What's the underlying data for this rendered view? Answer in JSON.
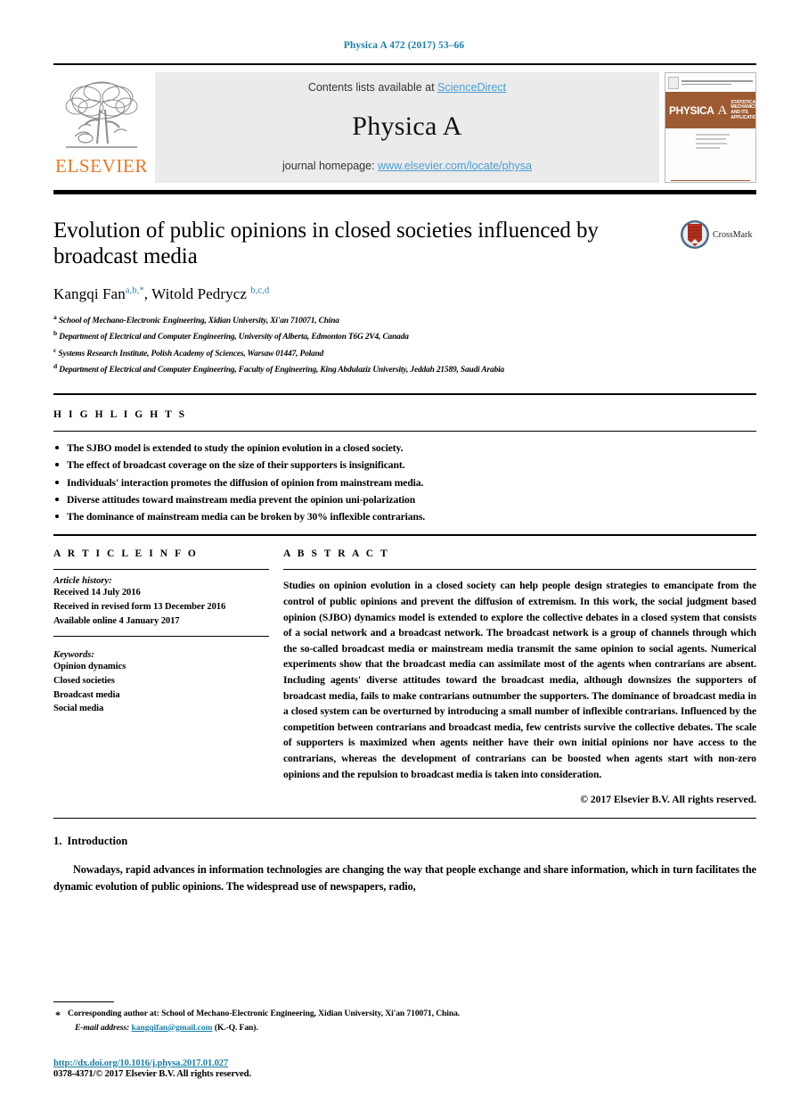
{
  "running_head": "Physica A 472 (2017) 53–66",
  "banner": {
    "publisher_logo_name": "elsevier-tree-logo",
    "publisher_wordmark": "ELSEVIER",
    "contents_prefix": "Contents lists available at ",
    "contents_link": "ScienceDirect",
    "journal_title": "Physica A",
    "homepage_prefix": "journal homepage: ",
    "homepage_link": "www.elsevier.com/locate/physa",
    "cover": {
      "title": "PHYSICA",
      "letter": "A",
      "subtitle": "STATISTICAL MECHANICS AND ITS APPLICATIONS"
    }
  },
  "article": {
    "title": "Evolution of public opinions in closed societies influenced by broadcast media",
    "crossmark_label": "CrossMark",
    "authors_html": "Kangqi Fan<sup>a,b,*</sup>, Witold Pedrycz <sup>b,c,d</sup>",
    "affiliations": [
      {
        "marker": "a",
        "text": "School of Mechano-Electronic Engineering, Xidian University, Xi'an 710071, China"
      },
      {
        "marker": "b",
        "text": "Department of Electrical and Computer Engineering, University of Alberta, Edmonton T6G 2V4, Canada"
      },
      {
        "marker": "c",
        "text": "Systems Research Institute, Polish Academy of Sciences, Warsaw 01447, Poland"
      },
      {
        "marker": "d",
        "text": "Department of Electrical and Computer Engineering, Faculty of Engineering, King Abdulaziz University, Jeddah 21589, Saudi Arabia"
      }
    ]
  },
  "highlights": {
    "heading": "H I G H L I G H T S",
    "items": [
      "The SJBO model is extended to study the opinion evolution in a closed society.",
      "The effect of broadcast coverage on the size of their supporters is insignificant.",
      "Individuals' interaction promotes the diffusion of opinion from mainstream media.",
      "Diverse attitudes toward mainstream media prevent the opinion uni-polarization",
      "The dominance of mainstream media can be broken by 30% inflexible contrarians."
    ]
  },
  "article_info": {
    "heading": "A R T I C L E    I N F O",
    "history_title": "Article history:",
    "history": [
      "Received 14 July 2016",
      "Received in revised form 13 December 2016",
      "Available online 4 January 2017"
    ],
    "keywords_title": "Keywords:",
    "keywords": [
      "Opinion dynamics",
      "Closed societies",
      "Broadcast media",
      "Social media"
    ]
  },
  "abstract": {
    "heading": "A B S T R A C T",
    "text": "Studies on opinion evolution in a closed society can help people design strategies to emancipate from the control of public opinions and prevent the diffusion of extremism. In this work, the social judgment based opinion (SJBO) dynamics model is extended to explore the collective debates in a closed system that consists of a social network and a broadcast network. The broadcast network is a group of channels through which the so-called broadcast media or mainstream media transmit the same opinion to social agents. Numerical experiments show that the broadcast media can assimilate most of the agents when contrarians are absent. Including agents' diverse attitudes toward the broadcast media, although downsizes the supporters of broadcast media, fails to make contrarians outnumber the supporters. The dominance of broadcast media in a closed system can be overturned by introducing a small number of inflexible contrarians. Influenced by the competition between contrarians and broadcast media, few centrists survive the collective debates. The scale of supporters is maximized when agents neither have their own initial opinions nor have access to the contrarians, whereas the development of contrarians can be boosted when agents start with non-zero opinions and the repulsion to broadcast media is taken into consideration.",
    "copyright": "© 2017 Elsevier B.V. All rights reserved."
  },
  "introduction": {
    "number": "1.",
    "heading": "Introduction",
    "paragraph": "Nowadays, rapid advances in information technologies are changing the way that people exchange and share information, which in turn facilitates the dynamic evolution of public opinions. The widespread use of newspapers, radio,"
  },
  "footnote": {
    "corresponding": "Corresponding author at: School of Mechano-Electronic Engineering, Xidian University, Xi'an 710071, China.",
    "email_label": "E-mail address:",
    "email": "kangqifan@gmail.com",
    "email_suffix": "(K.-Q. Fan).",
    "doi": "http://dx.doi.org/10.1016/j.physa.2017.01.027",
    "issn": "0378-4371/© 2017 Elsevier B.V. All rights reserved."
  },
  "colors": {
    "link_blue": "#1b7fa8",
    "banner_link_blue": "#4a9fd5",
    "elsevier_orange": "#E87722",
    "cover_brown": "#9e5b32"
  }
}
